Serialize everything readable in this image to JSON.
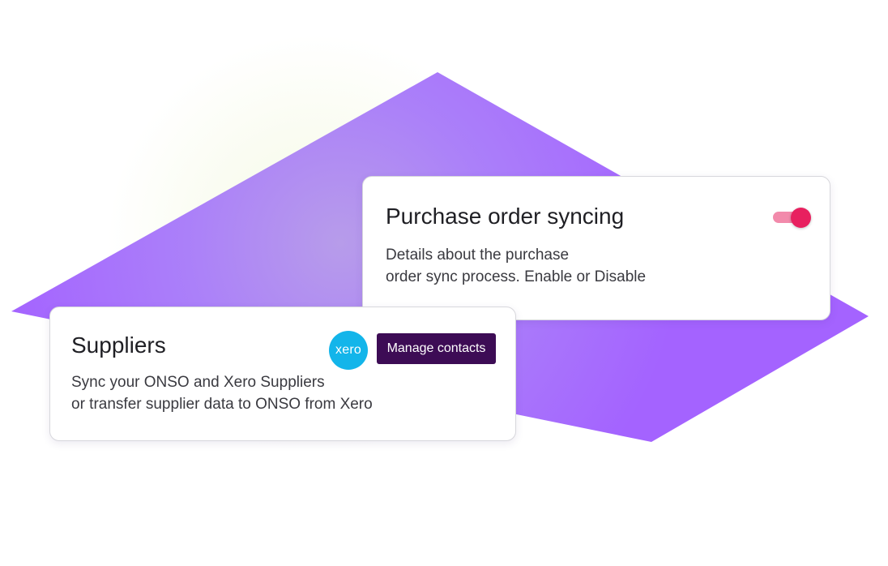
{
  "purchase_order_card": {
    "title": "Purchase order syncing",
    "description_line1": "Details about the purchase",
    "description_line2": "order sync process. Enable or Disable",
    "toggle_enabled": true
  },
  "suppliers_card": {
    "title": "Suppliers",
    "description_line1": "Sync your ONSO and Xero Suppliers",
    "description_line2": "or transfer supplier data to ONSO from Xero",
    "logo_text": "xero",
    "button_label": "Manage contacts"
  },
  "icons": {
    "toggle": "toggle-switch-icon",
    "xero_logo": "xero-logo-icon"
  },
  "colors": {
    "shape_purple": "#a66bff",
    "toggle_track": "#f28aab",
    "toggle_thumb": "#e8205f",
    "xero_blue": "#13b5ea",
    "button_bg": "#3d0c55"
  }
}
